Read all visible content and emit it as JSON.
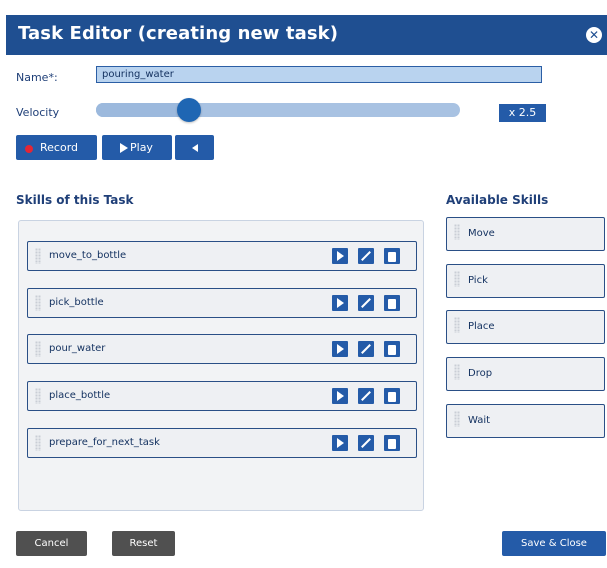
{
  "window": {
    "title": "Task Editor (creating new task)",
    "close_icon": "close-icon"
  },
  "form": {
    "name_label": "Name*:",
    "name_value": "pouring_water",
    "velocity_label": "Velocity",
    "velocity_value": "x 2.5",
    "velocity_slider_fraction": 0.255
  },
  "controls": {
    "record_label": "Record",
    "play_label": "Play"
  },
  "skills_of_task": {
    "title": "Skills of this Task",
    "items": [
      {
        "label": "move_to_bottle"
      },
      {
        "label": "pick_bottle"
      },
      {
        "label": "pour_water"
      },
      {
        "label": "place_bottle"
      },
      {
        "label": "prepare_for_next_task"
      }
    ]
  },
  "available_skills": {
    "title": "Available Skills",
    "items": [
      {
        "label": "Move"
      },
      {
        "label": "Pick"
      },
      {
        "label": "Place"
      },
      {
        "label": "Drop"
      },
      {
        "label": "Wait"
      }
    ]
  },
  "footer": {
    "cancel_label": "Cancel",
    "reset_label": "Reset",
    "save_label": "Save & Close"
  },
  "colors": {
    "primary": "#245ba8",
    "titlebar": "#1f4f91",
    "record_dot": "#e32636",
    "neutral_button": "#505050"
  }
}
